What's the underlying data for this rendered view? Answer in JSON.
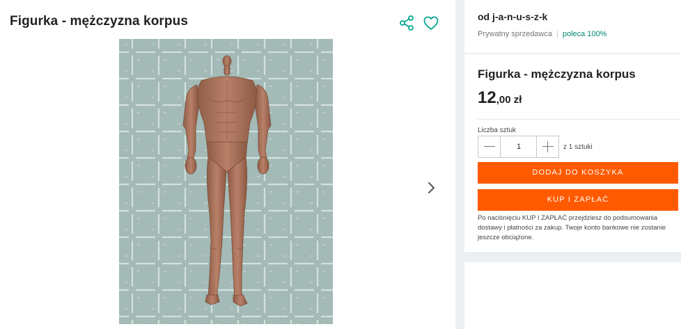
{
  "product": {
    "title": "Figurka - mężczyzna korpus",
    "photo_alt": "figure-photo"
  },
  "icons": {
    "share": "share-icon",
    "favorite": "heart-icon",
    "next": "chevron-right-icon"
  },
  "seller": {
    "name": "od j-a-n-u-s-z-k",
    "type": "Prywatny sprzedawca",
    "rating": "poleca 100%"
  },
  "purchase": {
    "title": "Figurka - mężczyzna korpus",
    "price_main": "12",
    "price_rest": ",00 zł",
    "quantity_label": "Liczba sztuk",
    "quantity_value": "1",
    "quantity_of": "z 1 sztuki",
    "add_to_cart": "DODAJ DO KOSZYKA",
    "buy_now": "KUP I ZAPŁAĆ",
    "note": "Po naciśnięciu KUP I ZAPŁAĆ przejdziesz do podsumowania dostawy i płatności za zakup. Twoje konto bankowe nie zostanie jeszcze obciążone."
  },
  "colors": {
    "accent": "#ff5a00",
    "icon_teal": "#00a790",
    "rating_green": "#00866b"
  }
}
